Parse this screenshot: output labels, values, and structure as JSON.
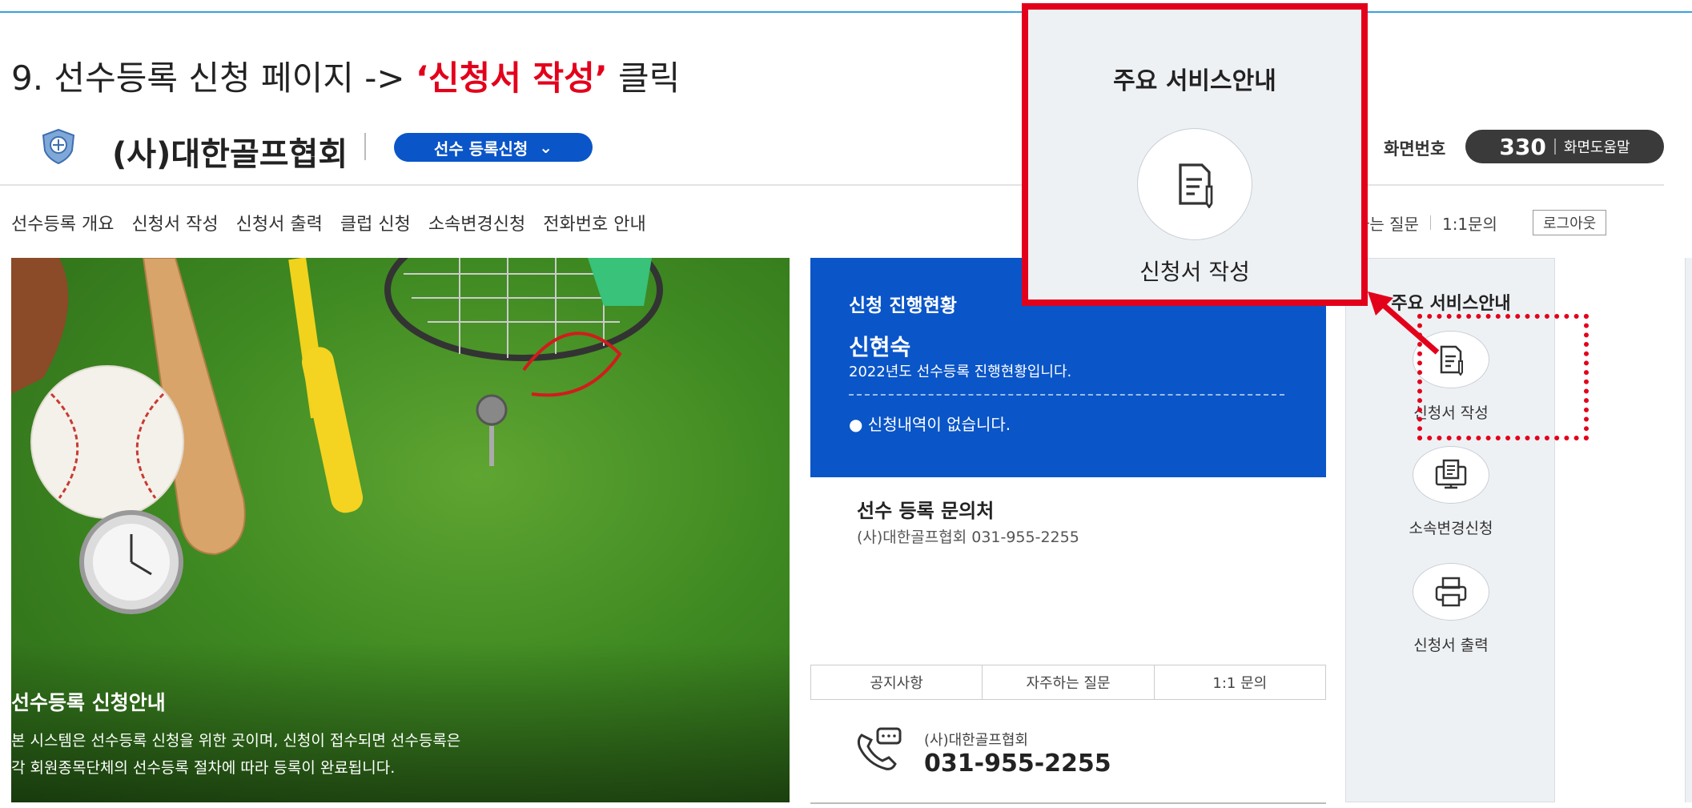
{
  "instruction": {
    "prefix": "9. 선수등록 신청 페이지 ->",
    "highlight": "‘신청서 작성’",
    "suffix": "클릭"
  },
  "header": {
    "brand": "(사)대한골프협회",
    "menu_pill": "선수 등록신청",
    "screen_no_label": "화면번호",
    "screen_no": "330",
    "screen_help": "화면도움말"
  },
  "nav": {
    "items": [
      "선수등록 개요",
      "신청서 작성",
      "신청서 출력",
      "클럽 신청",
      "소속변경신청",
      "전화번호 안내"
    ]
  },
  "top_links": {
    "faq": "하는 질문",
    "inquiry": "1:1문의",
    "logout": "로그아웃"
  },
  "hero": {
    "title": "선수등록 신청안내",
    "line1": "본 시스템은 선수등록 신청을 위한 곳이며, 신청이 접수되면 선수등록은",
    "line2": "각 회원종목단체의 선수등록 절차에 따라 등록이 완료됩니다."
  },
  "status": {
    "title": "신청 진행현황",
    "name": "신현숙",
    "subtitle": "2022년도 선수등록 진행현황입니다.",
    "empty": "● 신청내역이 없습니다."
  },
  "inquiry": {
    "title": "선수 등록 문의처",
    "contact": "(사)대한골프협회  031-955-2255"
  },
  "tabs": [
    "공지사항",
    "자주하는 질문",
    "1:1 문의"
  ],
  "phone": {
    "org": "(사)대한골프협회",
    "number": "031-955-2255"
  },
  "services": {
    "title": "주요 서비스안내",
    "items": [
      {
        "label": "신청서 작성",
        "icon": "document-pen-icon"
      },
      {
        "label": "소속변경신청",
        "icon": "monitor-document-icon"
      },
      {
        "label": "신청서 출력",
        "icon": "printer-icon"
      }
    ]
  },
  "zoom": {
    "title": "주요 서비스안내",
    "label": "신청서 작성"
  },
  "colors": {
    "accent_blue": "#0a55c8",
    "highlight_red": "#e3001b",
    "panel_bg": "#eef1f4"
  }
}
